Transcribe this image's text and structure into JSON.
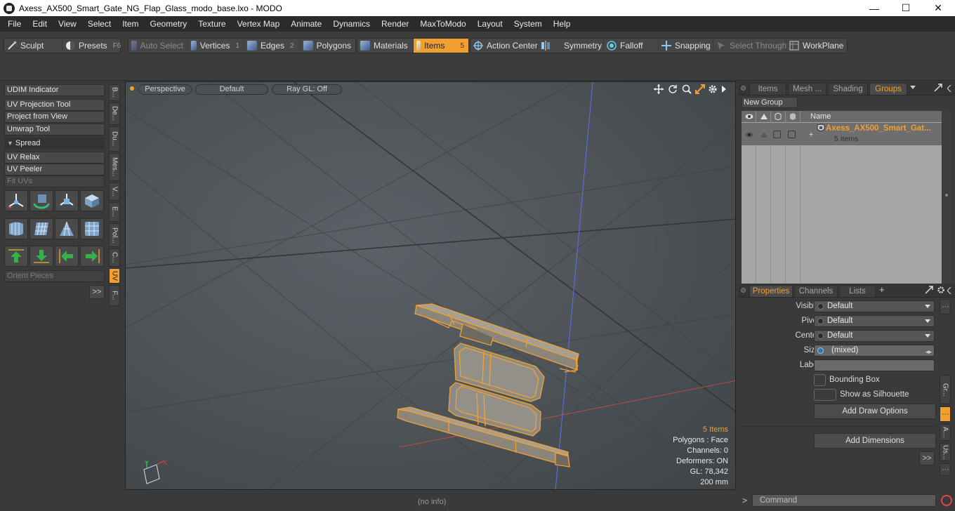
{
  "window": {
    "title": "Axess_AX500_Smart_Gate_NG_Flap_Glass_modo_base.lxo - MODO",
    "controls": {
      "minimize": "—",
      "maximize": "☐",
      "close": "✕"
    }
  },
  "menubar": {
    "items": [
      "File",
      "Edit",
      "View",
      "Select",
      "Item",
      "Geometry",
      "Texture",
      "Vertex Map",
      "Animate",
      "Dynamics",
      "Render",
      "MaxToModo",
      "Layout",
      "System",
      "Help"
    ]
  },
  "toolbar": {
    "sculpt": "Sculpt",
    "presets": "Presets",
    "presets_key": "F6",
    "auto_select": "Auto Select",
    "vertices": "Vertices",
    "vertices_key": "1",
    "edges": "Edges",
    "edges_key": "2",
    "polygons": "Polygons",
    "materials": "Materials",
    "items": "Items",
    "items_key": "5",
    "action_center": "Action Center",
    "symmetry": "Symmetry",
    "falloff": "Falloff",
    "snapping": "Snapping",
    "select_through": "Select Through",
    "workplane": "WorkPlane"
  },
  "left_panel": {
    "buttons": [
      "UDIM Indicator",
      "UV Projection Tool",
      "Project from View",
      "Unwrap Tool"
    ],
    "spread_section": "Spread",
    "buttons2": [
      "UV Relax",
      "UV Peeler"
    ],
    "fit_uvs": "Fit UVs",
    "orient_pieces": "Orient Pieces",
    "more": ">>",
    "vertical_tabs": [
      "B...",
      "De...",
      "Du...",
      "Mes...",
      "V...",
      "E...",
      "Pol...",
      "C...",
      "UV",
      "F..."
    ]
  },
  "viewport": {
    "view_mode": "Perspective",
    "shading": "Default",
    "ray_gl": "Ray GL: Off",
    "info": {
      "items": "5 Items",
      "polygons": "Polygons : Face",
      "channels": "Channels: 0",
      "deformers": "Deformers: ON",
      "gl": "GL: 78,342",
      "scale": "200 mm"
    },
    "axis_labels": {
      "y": "Y",
      "x": "X"
    }
  },
  "status_bar": {
    "text": "(no info)"
  },
  "groups_panel": {
    "tabs": [
      "Items",
      "Mesh ...",
      "Shading",
      "Groups"
    ],
    "active_tab": "Groups",
    "new_group": "New Group",
    "column_name": "Name",
    "group": {
      "name": "Axess_AX500_Smart_Gat...",
      "count": "5 Items"
    }
  },
  "properties_panel": {
    "tabs": [
      "Properties",
      "Channels",
      "Lists"
    ],
    "add_tab": "+",
    "fields": {
      "visible_label": "Visible",
      "visible_value": "Default",
      "pivot_label": "Pivot",
      "pivot_value": "Default",
      "center_label": "Center",
      "center_value": "Default",
      "size_label": "Size",
      "size_value": "(mixed)",
      "label_label": "Label",
      "label_value": ""
    },
    "bounding_box": "Bounding Box",
    "show_as_silhouette": "Show as Silhouette",
    "add_draw_options": "Add Draw Options",
    "add_dimensions": "Add Dimensions",
    "more": ">>",
    "side_tabs": [
      "Gr...",
      "A...",
      "Us..."
    ]
  },
  "command_bar": {
    "prompt": ">",
    "placeholder": "Command"
  },
  "colors": {
    "accent": "#f0a030",
    "bg": "#3a3a3a",
    "viewport": "#4d5357",
    "wire": "#f0a030"
  }
}
